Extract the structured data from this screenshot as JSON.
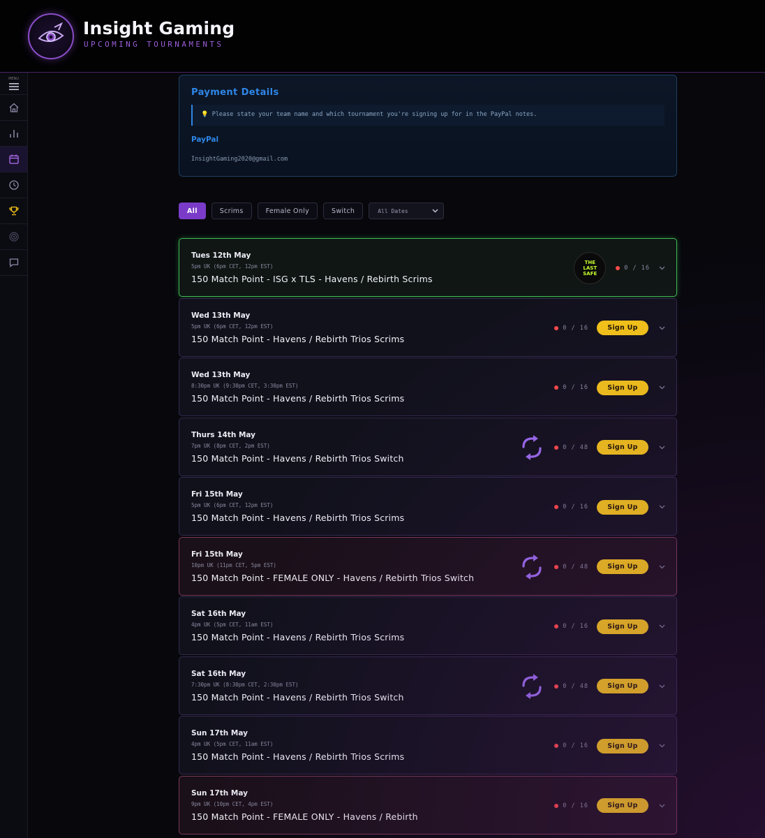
{
  "app": {
    "title": "Insight Gaming",
    "subtitle": "UPCOMING TOURNAMENTS",
    "menu_label": "MENU"
  },
  "sidebar": {
    "items": [
      {
        "icon": "home-icon"
      },
      {
        "icon": "bar-chart-icon"
      },
      {
        "icon": "calendar-icon",
        "active": true
      },
      {
        "icon": "clock-icon"
      },
      {
        "icon": "trophy-icon"
      },
      {
        "icon": "target-icon"
      },
      {
        "icon": "chat-icon"
      }
    ]
  },
  "payment": {
    "title": "Payment Details",
    "note": "💡 Please state your team name and which tournament you're signing up for in the PayPal notes.",
    "paypal_label": "PayPal",
    "email": "InsightGaming2020@gmail.com"
  },
  "filters": {
    "buttons": [
      "All",
      "Scrims",
      "Female Only",
      "Switch"
    ],
    "active": "All",
    "date_select": "All Dates"
  },
  "events": [
    {
      "date": "Tues 12th May",
      "time": "5pm UK (6pm CET, 12pm EST)",
      "title": "150 Match Point - ISG x TLS - Havens / Rebirth Scrims",
      "slots": "0 / 16",
      "badge": "THE LAST SAFE",
      "type": "featured"
    },
    {
      "date": "Wed 13th May",
      "time": "5pm UK (6pm CET, 12pm EST)",
      "title": "150 Match Point - Havens / Rebirth Trios Scrims",
      "slots": "0 / 16",
      "signup": "Sign Up",
      "type": "scrims"
    },
    {
      "date": "Wed 13th May",
      "time": "8:30pm UK (9:30pm CET, 3:30pm EST)",
      "title": "150 Match Point - Havens / Rebirth Trios Scrims",
      "slots": "0 / 16",
      "signup": "Sign Up",
      "type": "scrims"
    },
    {
      "date": "Thurs 14th May",
      "time": "7pm UK (8pm CET, 2pm EST)",
      "title": "150 Match Point - Havens / Rebirth Trios Switch",
      "slots": "0 / 48",
      "signup": "Sign Up",
      "type": "switch"
    },
    {
      "date": "Fri 15th May",
      "time": "5pm UK (6pm CET, 12pm EST)",
      "title": "150 Match Point - Havens / Rebirth Trios Scrims",
      "slots": "0 / 16",
      "signup": "Sign Up",
      "type": "scrims"
    },
    {
      "date": "Fri 15th May",
      "time": "10pm UK (11pm CET, 5pm EST)",
      "title": "150 Match Point - FEMALE ONLY - Havens / Rebirth Trios Switch",
      "slots": "0 / 48",
      "signup": "Sign Up",
      "type": "female-switch"
    },
    {
      "date": "Sat 16th May",
      "time": "4pm UK (5pm CET, 11am EST)",
      "title": "150 Match Point - Havens / Rebirth Trios Scrims",
      "slots": "0 / 16",
      "signup": "Sign Up",
      "type": "scrims"
    },
    {
      "date": "Sat 16th May",
      "time": "7:30pm UK (8:30pm CET, 2:30pm EST)",
      "title": "150 Match Point - Havens / Rebirth Trios Switch",
      "slots": "0 / 48",
      "signup": "Sign Up",
      "type": "switch"
    },
    {
      "date": "Sun 17th May",
      "time": "4pm UK (5pm CET, 11am EST)",
      "title": "150 Match Point - Havens / Rebirth Trios Scrims",
      "slots": "0 / 16",
      "signup": "Sign Up",
      "type": "scrims"
    },
    {
      "date": "Sun 17th May",
      "time": "9pm UK (10pm CET, 4pm EST)",
      "title": "150 Match Point - FEMALE ONLY - Havens / Rebirth",
      "slots": "0 / 16",
      "signup": "Sign Up",
      "type": "female"
    }
  ],
  "colors": {
    "accent": "#7a3cc8",
    "signup": "#f5c518",
    "payment_blue": "#2f86e8",
    "featured_border": "#3fbf55",
    "female_border": "#7a3a5a",
    "slot_dot": "#ff4a4a"
  }
}
